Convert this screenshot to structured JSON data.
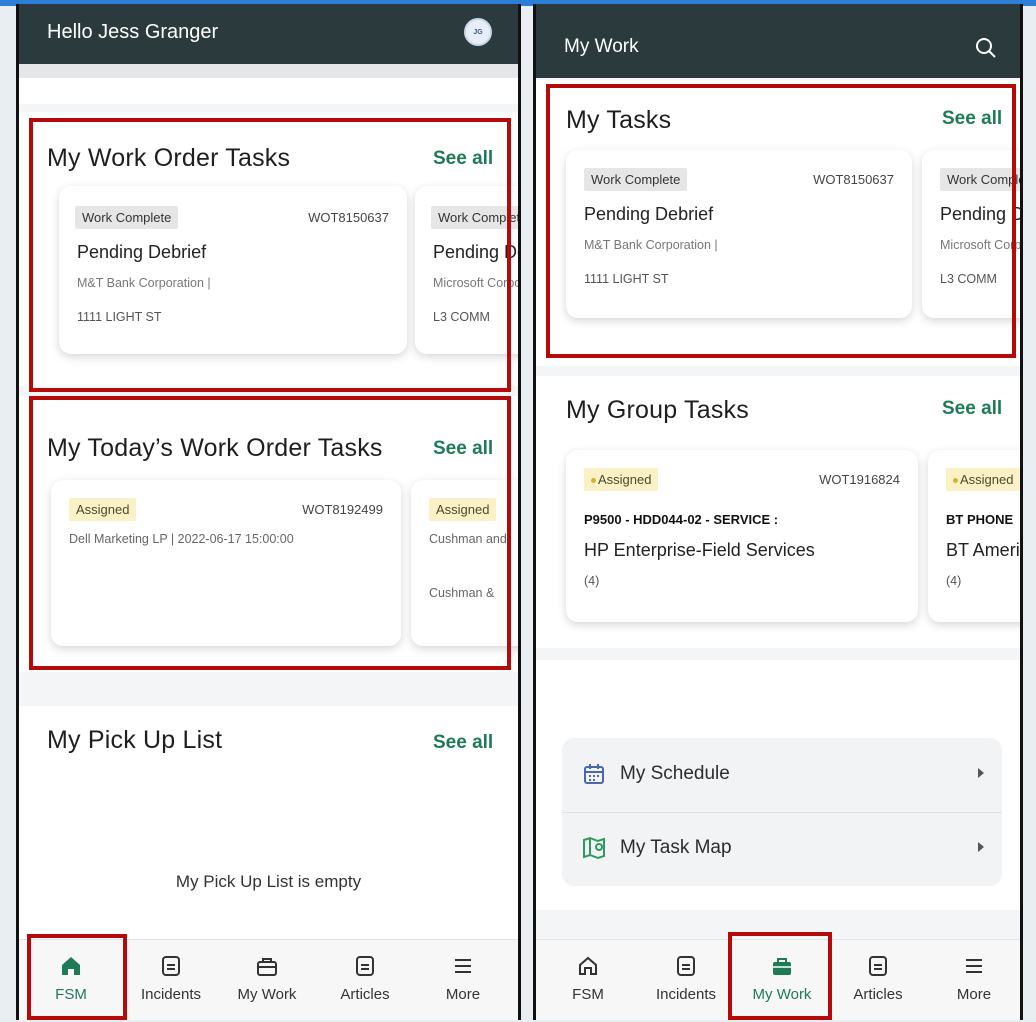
{
  "left": {
    "greeting": "Hello Jess Granger",
    "avatar_initials": "JG",
    "work_order_tasks": {
      "title": "My Work Order Tasks",
      "see_all": "See all",
      "cards": [
        {
          "status": "Work Complete",
          "number": "WOT8150637",
          "title": "Pending Debrief",
          "company": "M&T Bank Corporation  |",
          "address": "1111 LIGHT ST"
        },
        {
          "status": "Work Complete",
          "title": "Pending Debrief",
          "company": "Microsoft Corporation",
          "address": "L3 COMM"
        }
      ]
    },
    "today_tasks": {
      "title": "My Today’s Work Order Tasks",
      "see_all": "See all",
      "cards": [
        {
          "status": "Assigned",
          "number": "WOT8192499",
          "company": "Dell Marketing LP  |  2022-06-17 15:00:00"
        },
        {
          "status": "Assigned",
          "company": "Cushman and",
          "company2": "Cushman &"
        }
      ]
    },
    "pickup": {
      "title": "My Pick Up List",
      "see_all": "See all",
      "empty": "My Pick Up List is empty"
    },
    "nav": [
      {
        "label": "FSM",
        "icon": "home-icon",
        "active": true
      },
      {
        "label": "Incidents",
        "icon": "document-icon"
      },
      {
        "label": "My Work",
        "icon": "briefcase-icon"
      },
      {
        "label": "Articles",
        "icon": "document-icon"
      },
      {
        "label": "More",
        "icon": "menu-icon"
      }
    ]
  },
  "right": {
    "title": "My Work",
    "my_tasks": {
      "title": "My Tasks",
      "see_all": "See all",
      "cards": [
        {
          "status": "Work Complete",
          "number": "WOT8150637",
          "title": "Pending Debrief",
          "company": "M&T Bank Corporation  |",
          "address": "1111 LIGHT ST"
        },
        {
          "status": "Work Complete",
          "title": "Pending Debrief",
          "company": "Microsoft Corporation",
          "address": "L3 COMM"
        }
      ]
    },
    "group_tasks": {
      "title": "My Group Tasks",
      "see_all": "See all",
      "cards": [
        {
          "status": "Assigned",
          "number": "WOT1916824",
          "line1": "P9500 - HDD044-02 - SERVICE :",
          "title": "HP Enterprise-Field Services",
          "count": "(4)"
        },
        {
          "status": "Assigned",
          "line1": "BT PHONE",
          "title": "BT Americas",
          "count": "(4)"
        }
      ]
    },
    "menu": [
      {
        "label": "My Schedule",
        "icon": "calendar-icon"
      },
      {
        "label": "My Task Map",
        "icon": "map-icon"
      }
    ],
    "nav": [
      {
        "label": "FSM",
        "icon": "home-icon"
      },
      {
        "label": "Incidents",
        "icon": "document-icon"
      },
      {
        "label": "My Work",
        "icon": "briefcase-icon",
        "active": true
      },
      {
        "label": "Articles",
        "icon": "document-icon"
      },
      {
        "label": "More",
        "icon": "menu-icon"
      }
    ]
  },
  "colors": {
    "appbar": "#2b3a3c",
    "accent": "#1f7a56",
    "highlight": "#b50a0a"
  }
}
